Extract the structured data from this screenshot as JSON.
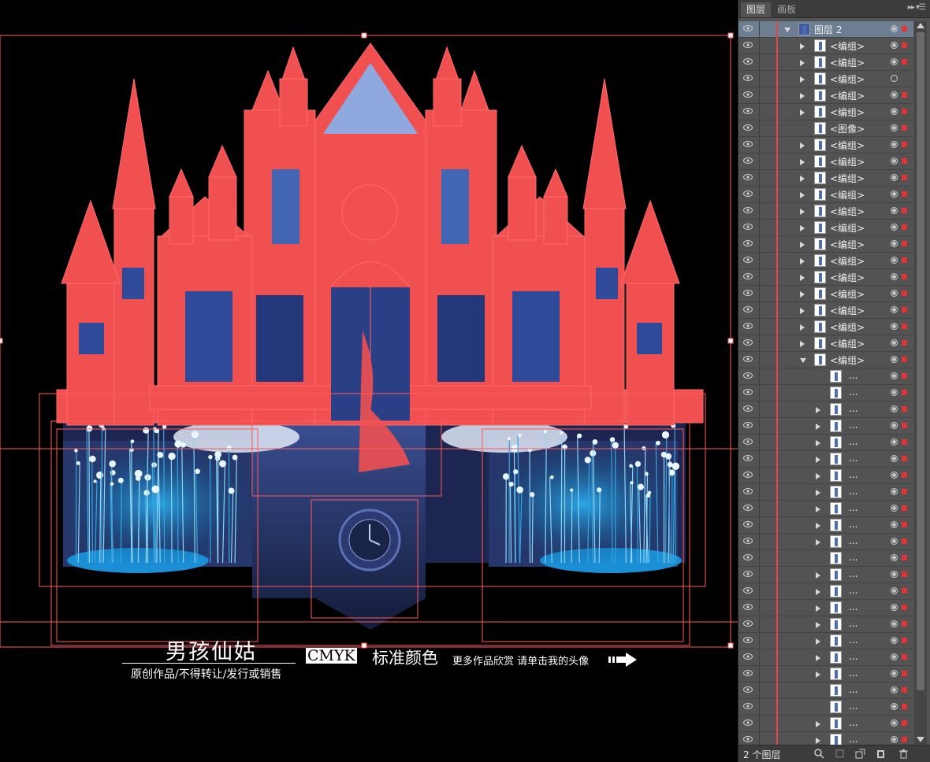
{
  "canvas": {
    "signature_title": "男孩仙姑",
    "signature_subtitle": "原创作品/不得转让/发行或销售",
    "cmyk_label": "CMYK",
    "standard_color_label": "标准颜色",
    "more_works_text": "更多作品欣赏 请单击我的头像",
    "selection_color": "#ff5a5a",
    "castle_base_color": "#4a66b0",
    "glow_color": "#1f86c8"
  },
  "panel": {
    "tabs": [
      {
        "label": "图层",
        "active": true
      },
      {
        "label": "画板",
        "active": false
      }
    ],
    "menu_icon": "panel-menu-icon",
    "footer_count": "2 个图层",
    "rows": [
      {
        "label": "图层 2",
        "level": 0,
        "expanded": true,
        "selected": true,
        "target": "full",
        "marked": true
      },
      {
        "label": "<编组>",
        "level": 1,
        "expanded": false,
        "target": "full",
        "marked": true
      },
      {
        "label": "<编组>",
        "level": 1,
        "expanded": false,
        "target": "full",
        "marked": true
      },
      {
        "label": "<编组>",
        "level": 1,
        "expanded": false,
        "target": "empty",
        "marked": false
      },
      {
        "label": "<编组>",
        "level": 1,
        "expanded": false,
        "target": "full",
        "marked": true
      },
      {
        "label": "<编组>",
        "level": 1,
        "expanded": false,
        "target": "full",
        "marked": true
      },
      {
        "label": "<图像>",
        "level": 1,
        "leaf": true,
        "target": "full",
        "marked": true
      },
      {
        "label": "<编组>",
        "level": 1,
        "expanded": false,
        "target": "full",
        "marked": true
      },
      {
        "label": "<编组>",
        "level": 1,
        "expanded": false,
        "target": "full",
        "marked": true
      },
      {
        "label": "<编组>",
        "level": 1,
        "expanded": false,
        "target": "full",
        "marked": true
      },
      {
        "label": "<编组>",
        "level": 1,
        "expanded": false,
        "target": "full",
        "marked": true
      },
      {
        "label": "<编组>",
        "level": 1,
        "expanded": false,
        "target": "full",
        "marked": true
      },
      {
        "label": "<编组>",
        "level": 1,
        "expanded": false,
        "target": "full",
        "marked": true
      },
      {
        "label": "<编组>",
        "level": 1,
        "expanded": false,
        "target": "full",
        "marked": true
      },
      {
        "label": "<编组>",
        "level": 1,
        "expanded": false,
        "target": "full",
        "marked": true
      },
      {
        "label": "<编组>",
        "level": 1,
        "expanded": false,
        "target": "full",
        "marked": true
      },
      {
        "label": "<编组>",
        "level": 1,
        "expanded": false,
        "target": "full",
        "marked": true
      },
      {
        "label": "<编组>",
        "level": 1,
        "expanded": false,
        "target": "full",
        "marked": true
      },
      {
        "label": "<编组>",
        "level": 1,
        "expanded": false,
        "target": "full",
        "marked": true
      },
      {
        "label": "<编组>",
        "level": 1,
        "expanded": false,
        "target": "full",
        "marked": true
      },
      {
        "label": "<编组>",
        "level": 1,
        "expanded": true,
        "target": "full",
        "marked": true
      },
      {
        "label": "...",
        "level": 2,
        "leaf": true,
        "target": "full",
        "marked": true
      },
      {
        "label": "...",
        "level": 2,
        "leaf": true,
        "target": "full",
        "marked": true
      },
      {
        "label": "...",
        "level": 2,
        "expanded": false,
        "target": "full",
        "marked": true
      },
      {
        "label": "...",
        "level": 2,
        "expanded": false,
        "target": "full",
        "marked": true
      },
      {
        "label": "...",
        "level": 2,
        "expanded": false,
        "target": "full",
        "marked": true
      },
      {
        "label": "...",
        "level": 2,
        "expanded": false,
        "target": "full",
        "marked": true
      },
      {
        "label": "...",
        "level": 2,
        "expanded": false,
        "target": "full",
        "marked": true
      },
      {
        "label": "...",
        "level": 2,
        "expanded": false,
        "target": "full",
        "marked": true
      },
      {
        "label": "...",
        "level": 2,
        "expanded": false,
        "target": "full",
        "marked": true
      },
      {
        "label": "...",
        "level": 2,
        "expanded": false,
        "target": "full",
        "marked": true
      },
      {
        "label": "...",
        "level": 2,
        "expanded": false,
        "target": "full",
        "marked": true
      },
      {
        "label": "...",
        "level": 2,
        "leaf": true,
        "target": "full",
        "marked": true
      },
      {
        "label": "...",
        "level": 2,
        "expanded": false,
        "target": "full",
        "marked": true
      },
      {
        "label": "...",
        "level": 2,
        "expanded": false,
        "target": "full",
        "marked": true
      },
      {
        "label": "...",
        "level": 2,
        "expanded": false,
        "target": "full",
        "marked": true
      },
      {
        "label": "...",
        "level": 2,
        "expanded": false,
        "target": "full",
        "marked": true
      },
      {
        "label": "...",
        "level": 2,
        "expanded": false,
        "target": "full",
        "marked": true
      },
      {
        "label": "...",
        "level": 2,
        "expanded": false,
        "target": "full",
        "marked": true
      },
      {
        "label": "...",
        "level": 2,
        "expanded": false,
        "target": "full",
        "marked": true
      },
      {
        "label": "...",
        "level": 2,
        "leaf": true,
        "target": "full",
        "marked": true
      },
      {
        "label": "...",
        "level": 2,
        "leaf": true,
        "target": "full",
        "marked": true
      },
      {
        "label": "...",
        "level": 2,
        "expanded": false,
        "target": "full",
        "marked": true
      },
      {
        "label": "...",
        "level": 2,
        "expanded": false,
        "target": "full",
        "marked": true
      }
    ]
  }
}
